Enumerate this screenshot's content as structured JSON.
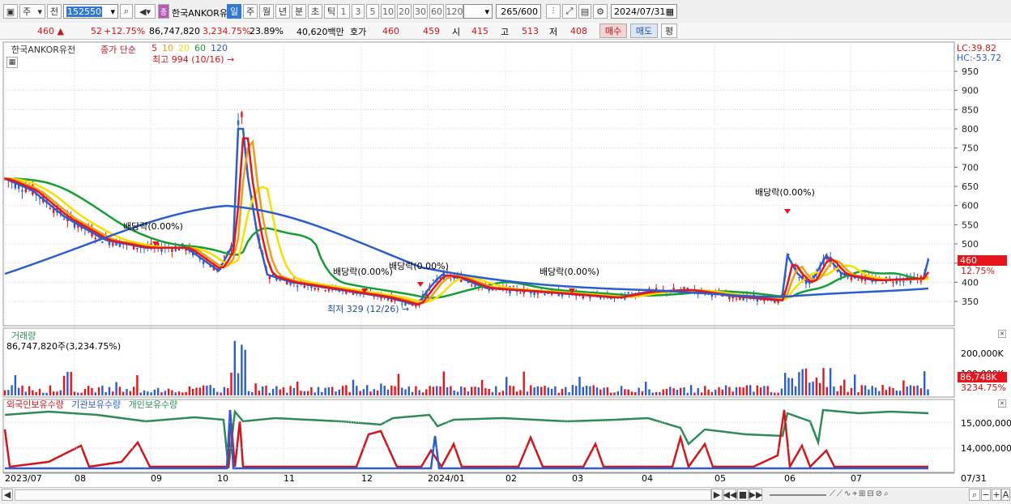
{
  "toolbar": {
    "period_mode": "주",
    "market_selector": "전",
    "code_input": "152550",
    "stock_name": "한국ANKOR유",
    "period_buttons": [
      "일",
      "주",
      "월",
      "년",
      "분",
      "초",
      "틱"
    ],
    "minute_buttons": [
      "1",
      "3",
      "5",
      "10",
      "20",
      "30",
      "60",
      "120"
    ],
    "count_value": "265",
    "count_total": "/600",
    "date_value": "2024/07/31"
  },
  "quote": {
    "price": "460",
    "change": "52",
    "change_pct": "+12.75%",
    "volume": "86,747,820",
    "volume_pct": "3,234.75%",
    "turnover_pct": "23.89%",
    "amount": "40,620백만",
    "quote_label": "호가",
    "ask": "460",
    "bid": "459",
    "open_label": "시",
    "open": "415",
    "high_label": "고",
    "high": "513",
    "low_label": "저",
    "low": "408",
    "buy_label": "매수",
    "sell_label": "매도",
    "eval_label": "평"
  },
  "price_panel": {
    "stock_label": "한국ANKOR유전",
    "ma_label": "종가 단순",
    "ma_periods": [
      "5",
      "10",
      "20",
      "60",
      "120"
    ],
    "ma_colors": [
      "#e8141b",
      "#f39c12",
      "#f5e000",
      "#159e35",
      "#2b5dcf"
    ],
    "lc": "LC:39.82",
    "hc": "HC:-53.72",
    "y_ticks": [
      "950",
      "900",
      "850",
      "800",
      "750",
      "700",
      "650",
      "600",
      "550",
      "500",
      "450",
      "400",
      "350"
    ],
    "current_price_tag": "460",
    "current_pct_tag": "12.75%",
    "high_marker": "최고 994 (10/16)",
    "low_marker": "최저 329 (12/26)",
    "dividend_labels": [
      "배당락(0.00%)",
      "배당락(0.00%)",
      "배당락(0.00%)",
      "배당락(0.00%)",
      "배당락(0.00%)"
    ]
  },
  "volume_panel": {
    "title": "거래량",
    "value_text": "86,747,820주(3,234.75%)",
    "y_ticks": [
      "200,000K",
      "100,000K"
    ],
    "current_tag": "86,748K",
    "current_pct_tag": "3234.75%"
  },
  "holding_panel": {
    "legend": [
      "외국인보유수량",
      "기관보유수량",
      "개인보유수량"
    ],
    "legend_colors": [
      "#d4141b",
      "#2b5dcf",
      "#2f8a5a"
    ],
    "y_ticks": [
      "15,000,000",
      "14,000,000"
    ]
  },
  "x_axis": {
    "labels": [
      "2023/07",
      "08",
      "09",
      "10",
      "11",
      "12",
      "2024/01",
      "02",
      "03",
      "04",
      "05",
      "06",
      "07"
    ],
    "end_label": "07/31"
  }
}
